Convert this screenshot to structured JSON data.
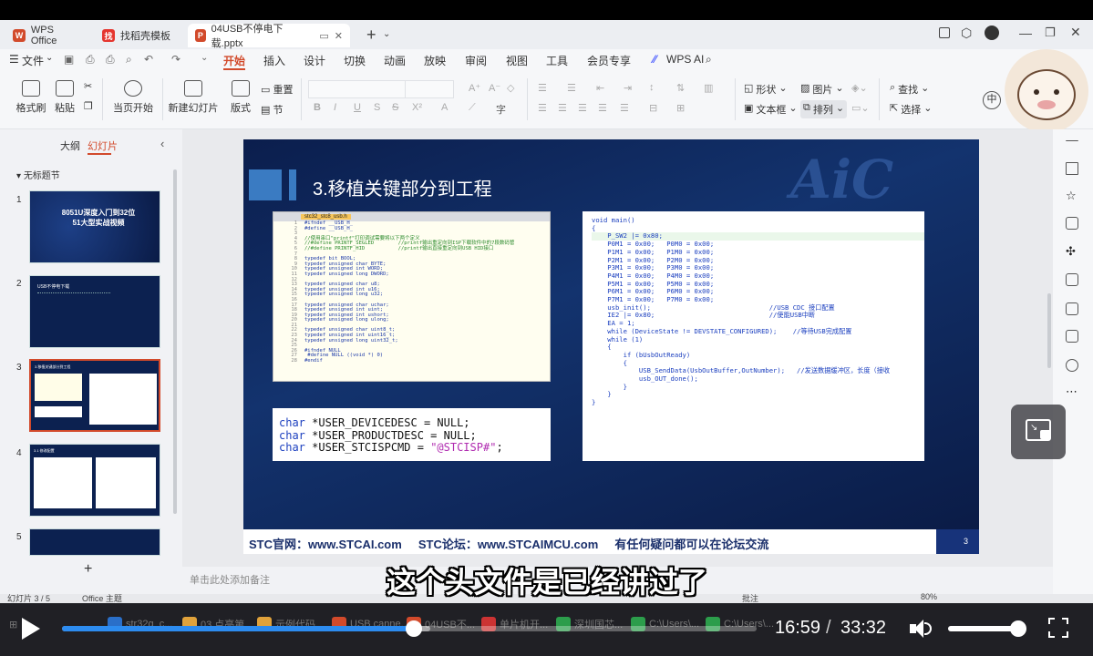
{
  "app": {
    "tabs": [
      {
        "label": "WPS Office",
        "color": "#d24a2b"
      },
      {
        "label": "找稻壳模板",
        "color": "#e5362f"
      },
      {
        "label": "04USB不停电下载.pptx",
        "color": "#d24a2b"
      }
    ],
    "new_tab": "+"
  },
  "menu": {
    "file": "文件",
    "items": [
      "开始",
      "插入",
      "设计",
      "切换",
      "动画",
      "放映",
      "审阅",
      "视图",
      "工具",
      "会员专享"
    ],
    "active": "开始",
    "wps_ai": "WPS AI"
  },
  "ribbon": {
    "format_painter": "格式刷",
    "paste": "粘贴",
    "start_from_current": "当页开始",
    "new_slide": "新建幻灯片",
    "layout": "版式",
    "reset": "重置",
    "section": "节",
    "shape": "形状",
    "picture": "图片",
    "find": "查找",
    "textbox": "文本框",
    "arrange": "排列",
    "select": "选择"
  },
  "left_panel": {
    "tab_outline": "大纲",
    "tab_slides": "幻灯片",
    "section": "无标题节",
    "slides": [
      {
        "num": "1",
        "title": "8051U深度入门到32位 51大型实战视频"
      },
      {
        "num": "2",
        "title": "USB不停电下载"
      },
      {
        "num": "3",
        "title": "3.移植关键部分到工程"
      },
      {
        "num": "4",
        "title": "3.1 修改配置"
      },
      {
        "num": "5",
        "title": ""
      }
    ],
    "selected": "3",
    "add": "+"
  },
  "slide": {
    "title": "3.移植关键部分到工程",
    "code_tab": "stc32_stc8_usb.h",
    "header_lines": [
      "#ifndef __USB_H_",
      "#define __USB_H_",
      "",
      "//使用串口\"printf\"打印调试需要将以下两个定义",
      "//#define PRINTF_SEGLED        //printf输出重定向到ISP下载软件中的7段数码管",
      "//#define PRINTF_HID           //printf输出直接重定向到USB HID接口",
      "",
      "typedef bit BOOL;",
      "typedef unsigned char BYTE;",
      "typedef unsigned int WORD;",
      "typedef unsigned long DWORD;",
      "",
      "typedef unsigned char u8;",
      "typedef unsigned int u16;",
      "typedef unsigned long u32;",
      "",
      "typedef unsigned char uchar;",
      "typedef unsigned int uint;",
      "typedef unsigned int ushort;",
      "typedef unsigned long ulong;",
      "",
      "typedef unsigned char uint8_t;",
      "typedef unsigned int uint16_t;",
      "typedef unsigned long uint32_t;",
      "",
      "#ifndef NULL",
      " #define NULL ((void *) 0)",
      "#endif"
    ],
    "decl_lines": [
      {
        "kw": "char",
        "rest": " *USER_DEVICEDESC = NULL;"
      },
      {
        "kw": "char",
        "rest": " *USER_PRODUCTDESC = NULL;"
      },
      {
        "kw": "char",
        "rest": " *USER_STCISPCMD = ",
        "str": "\"@STCISP#\"",
        "end": ";"
      }
    ],
    "main_lines": [
      "void main()",
      "{",
      "    P_SW2 |= 0x80;",
      "",
      "    P0M1 = 0x00;   P0M0 = 0x00;",
      "    P1M1 = 0x00;   P1M0 = 0x00;",
      "    P2M1 = 0x00;   P2M0 = 0x00;",
      "    P3M1 = 0x00;   P3M0 = 0x00;",
      "    P4M1 = 0x00;   P4M0 = 0x00;",
      "    P5M1 = 0x00;   P5M0 = 0x00;",
      "    P6M1 = 0x00;   P6M0 = 0x00;",
      "    P7M1 = 0x00;   P7M0 = 0x00;",
      "",
      "    usb_init();                              //USB CDC 接口配置",
      "",
      "    IE2 |= 0x80;                             //使能USB中断",
      "    EA = 1;",
      "",
      "    while (DeviceState != DEVSTATE_CONFIGURED);    //等待USB完成配置",
      "",
      "    while (1)",
      "    {",
      "        if (bUsbOutReady)",
      "        {",
      "            USB_SendData(UsbOutBuffer,OutNumber);   //发送数据缓冲区，长度（接收",
      "",
      "            usb_OUT_done();",
      "        }",
      "    }",
      "}"
    ],
    "footer": "STC官网：www.STCAI.com     STC论坛：www.STCAIMCU.com     有任何疑问都可以在论坛交流",
    "page": "3"
  },
  "notes_placeholder": "单击此处添加备注",
  "status": {
    "slide_of": "幻灯片 3 / 5",
    "theme": "Office 主题",
    "comment": "批注",
    "zoom": "80%"
  },
  "subtitle": "这个头文件是已经讲过了",
  "player": {
    "current": "16:59",
    "separator": "/",
    "total": "33:32",
    "progress": 0.507,
    "buffer": 0.53,
    "volume": 0.9
  },
  "taskbar": [
    "str32g_c...",
    "03 点亮第...",
    "示例代码",
    "USB canne...",
    "04USB不...",
    "单片机开...",
    "深圳国芯...",
    "C:\\Users\\...",
    "C:\\Users\\..."
  ]
}
